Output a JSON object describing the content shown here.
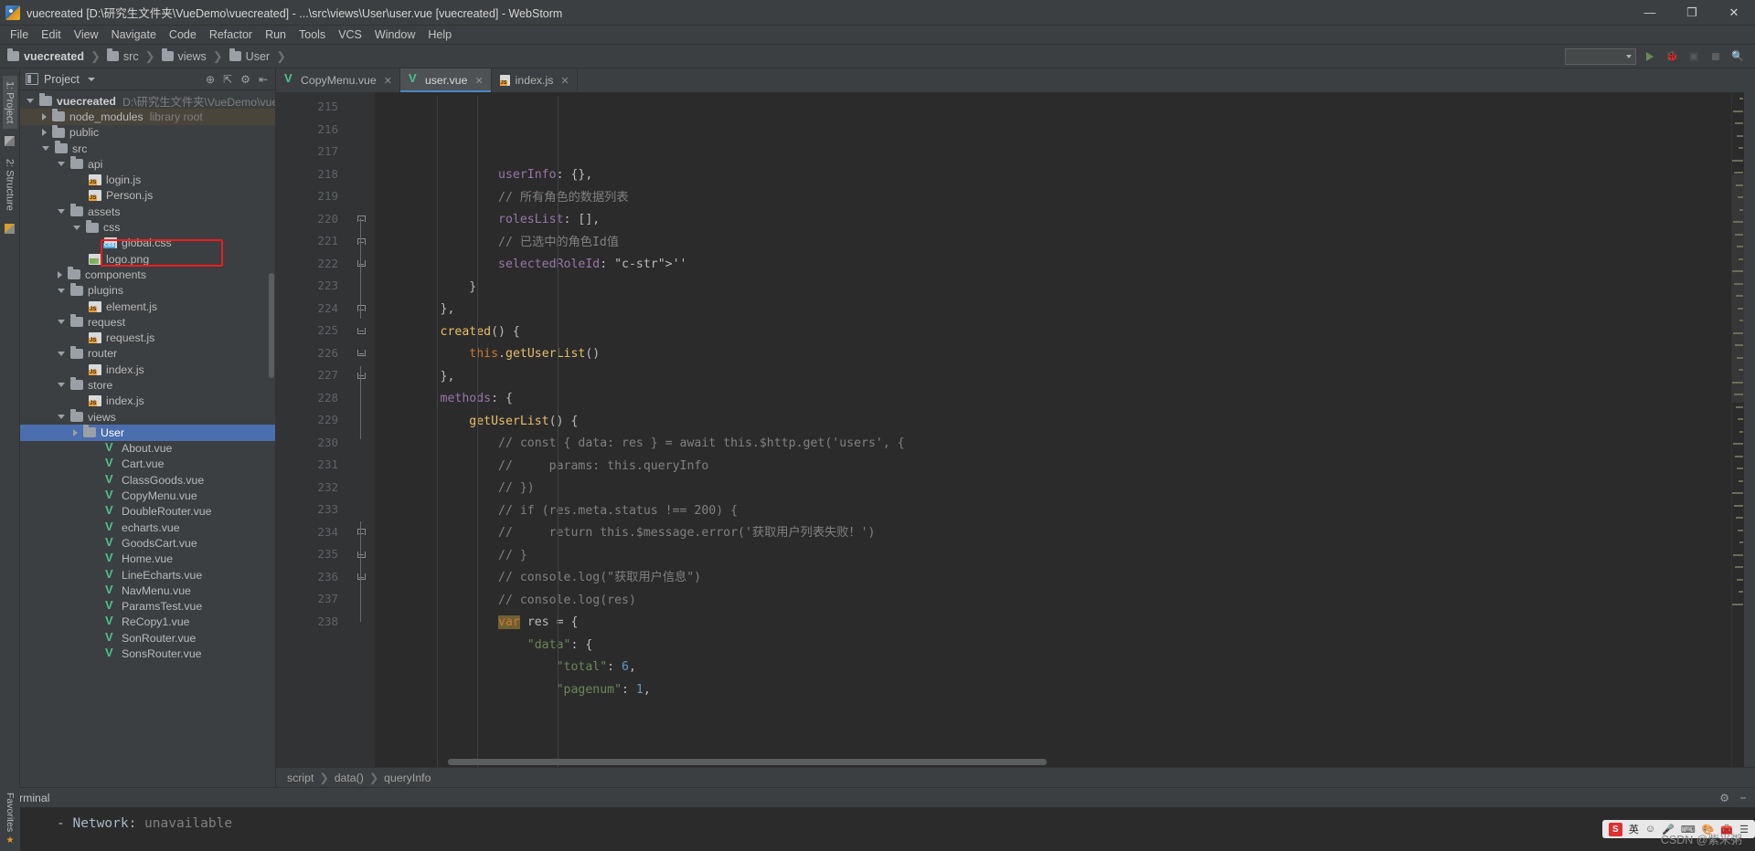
{
  "titlebar": {
    "title": "vuecreated [D:\\研究生文件夹\\VueDemo\\vuecreated] - ...\\src\\views\\User\\user.vue [vuecreated] - WebStorm",
    "minimize": "—",
    "maximize": "❐",
    "close": "✕",
    "app_icon": "webstorm-logo"
  },
  "menubar": {
    "items": [
      "File",
      "Edit",
      "View",
      "Navigate",
      "Code",
      "Refactor",
      "Run",
      "Tools",
      "VCS",
      "Window",
      "Help"
    ]
  },
  "breadcrumb": {
    "items": [
      "vuecreated",
      "src",
      "views",
      "User"
    ],
    "separator": "❯"
  },
  "left_rail": {
    "project_tab": "1: Project",
    "structure_tab": "2: Structure",
    "favorites_tab": "Favorites"
  },
  "project_panel": {
    "header_title": "Project",
    "tools": [
      "target-icon",
      "collapse-all-icon",
      "settings-icon",
      "hide-icon"
    ],
    "tree": [
      {
        "depth": 0,
        "twisty": "down",
        "icon": "folder",
        "label": "vuecreated",
        "bold": true,
        "sub": "D:\\研究生文件夹\\VueDemo\\vuecreated",
        "state": "normal"
      },
      {
        "depth": 1,
        "twisty": "right",
        "icon": "folder",
        "label": "node_modules",
        "bold": false,
        "sub": "library root",
        "state": "dim"
      },
      {
        "depth": 1,
        "twisty": "right",
        "icon": "folder",
        "label": "public",
        "bold": false,
        "sub": "",
        "state": "normal"
      },
      {
        "depth": 1,
        "twisty": "down",
        "icon": "folder",
        "label": "src",
        "bold": false,
        "sub": "",
        "state": "normal"
      },
      {
        "depth": 2,
        "twisty": "down",
        "icon": "folder",
        "label": "api",
        "bold": false,
        "sub": "",
        "state": "normal"
      },
      {
        "depth": 3,
        "twisty": "none",
        "icon": "js",
        "label": "login.js",
        "bold": false,
        "sub": "",
        "state": "normal"
      },
      {
        "depth": 3,
        "twisty": "none",
        "icon": "js",
        "label": "Person.js",
        "bold": false,
        "sub": "",
        "state": "normal"
      },
      {
        "depth": 2,
        "twisty": "down",
        "icon": "folder",
        "label": "assets",
        "bold": false,
        "sub": "",
        "state": "normal"
      },
      {
        "depth": 3,
        "twisty": "down",
        "icon": "folder",
        "label": "css",
        "bold": false,
        "sub": "",
        "state": "normal"
      },
      {
        "depth": 4,
        "twisty": "none",
        "icon": "css",
        "label": "global.css",
        "bold": false,
        "sub": "",
        "state": "normal"
      },
      {
        "depth": 3,
        "twisty": "none",
        "icon": "png",
        "label": "logo.png",
        "bold": false,
        "sub": "",
        "state": "normal"
      },
      {
        "depth": 2,
        "twisty": "right",
        "icon": "folder",
        "label": "components",
        "bold": false,
        "sub": "",
        "state": "normal"
      },
      {
        "depth": 2,
        "twisty": "down",
        "icon": "folder",
        "label": "plugins",
        "bold": false,
        "sub": "",
        "state": "normal"
      },
      {
        "depth": 3,
        "twisty": "none",
        "icon": "js",
        "label": "element.js",
        "bold": false,
        "sub": "",
        "state": "normal"
      },
      {
        "depth": 2,
        "twisty": "down",
        "icon": "folder",
        "label": "request",
        "bold": false,
        "sub": "",
        "state": "normal"
      },
      {
        "depth": 3,
        "twisty": "none",
        "icon": "js",
        "label": "request.js",
        "bold": false,
        "sub": "",
        "state": "normal"
      },
      {
        "depth": 2,
        "twisty": "down",
        "icon": "folder",
        "label": "router",
        "bold": false,
        "sub": "",
        "state": "normal"
      },
      {
        "depth": 3,
        "twisty": "none",
        "icon": "js",
        "label": "index.js",
        "bold": false,
        "sub": "",
        "state": "normal"
      },
      {
        "depth": 2,
        "twisty": "down",
        "icon": "folder",
        "label": "store",
        "bold": false,
        "sub": "",
        "state": "normal"
      },
      {
        "depth": 3,
        "twisty": "none",
        "icon": "js",
        "label": "index.js",
        "bold": false,
        "sub": "",
        "state": "normal"
      },
      {
        "depth": 2,
        "twisty": "down",
        "icon": "folder",
        "label": "views",
        "bold": false,
        "sub": "",
        "state": "normal"
      },
      {
        "depth": 3,
        "twisty": "right",
        "icon": "folder",
        "label": "User",
        "bold": false,
        "sub": "",
        "state": "selected"
      },
      {
        "depth": 4,
        "twisty": "none",
        "icon": "vue",
        "label": "About.vue",
        "bold": false,
        "sub": "",
        "state": "normal"
      },
      {
        "depth": 4,
        "twisty": "none",
        "icon": "vue",
        "label": "Cart.vue",
        "bold": false,
        "sub": "",
        "state": "normal"
      },
      {
        "depth": 4,
        "twisty": "none",
        "icon": "vue",
        "label": "ClassGoods.vue",
        "bold": false,
        "sub": "",
        "state": "normal"
      },
      {
        "depth": 4,
        "twisty": "none",
        "icon": "vue",
        "label": "CopyMenu.vue",
        "bold": false,
        "sub": "",
        "state": "normal"
      },
      {
        "depth": 4,
        "twisty": "none",
        "icon": "vue",
        "label": "DoubleRouter.vue",
        "bold": false,
        "sub": "",
        "state": "normal"
      },
      {
        "depth": 4,
        "twisty": "none",
        "icon": "vue",
        "label": "echarts.vue",
        "bold": false,
        "sub": "",
        "state": "normal"
      },
      {
        "depth": 4,
        "twisty": "none",
        "icon": "vue",
        "label": "GoodsCart.vue",
        "bold": false,
        "sub": "",
        "state": "normal"
      },
      {
        "depth": 4,
        "twisty": "none",
        "icon": "vue",
        "label": "Home.vue",
        "bold": false,
        "sub": "",
        "state": "normal"
      },
      {
        "depth": 4,
        "twisty": "none",
        "icon": "vue",
        "label": "LineEcharts.vue",
        "bold": false,
        "sub": "",
        "state": "normal"
      },
      {
        "depth": 4,
        "twisty": "none",
        "icon": "vue",
        "label": "NavMenu.vue",
        "bold": false,
        "sub": "",
        "state": "normal"
      },
      {
        "depth": 4,
        "twisty": "none",
        "icon": "vue",
        "label": "ParamsTest.vue",
        "bold": false,
        "sub": "",
        "state": "normal"
      },
      {
        "depth": 4,
        "twisty": "none",
        "icon": "vue",
        "label": "ReCopy1.vue",
        "bold": false,
        "sub": "",
        "state": "normal"
      },
      {
        "depth": 4,
        "twisty": "none",
        "icon": "vue",
        "label": "SonRouter.vue",
        "bold": false,
        "sub": "",
        "state": "normal"
      },
      {
        "depth": 4,
        "twisty": "none",
        "icon": "vue",
        "label": "SonsRouter.vue",
        "bold": false,
        "sub": "",
        "state": "normal"
      }
    ],
    "highlight_note": "red annotation box around global.css"
  },
  "editor": {
    "tabs": [
      {
        "label": "CopyMenu.vue",
        "icon": "vue",
        "active": false,
        "close": "✕"
      },
      {
        "label": "user.vue",
        "icon": "vue",
        "active": true,
        "close": "✕"
      },
      {
        "label": "index.js",
        "icon": "js",
        "active": false,
        "close": "✕"
      }
    ],
    "first_line_number": 215,
    "lines": [
      {
        "n": "215",
        "fold": "",
        "text": "                userInfo: {},"
      },
      {
        "n": "216",
        "fold": "",
        "text": "                // 所有角色的数据列表"
      },
      {
        "n": "217",
        "fold": "",
        "text": "                rolesList: [],"
      },
      {
        "n": "218",
        "fold": "",
        "text": "                // 已选中的角色Id值"
      },
      {
        "n": "219",
        "fold": "",
        "text": "                selectedRoleId: ''"
      },
      {
        "n": "220",
        "fold": "up",
        "text": "            }"
      },
      {
        "n": "221",
        "fold": "up",
        "text": "        },"
      },
      {
        "n": "222",
        "fold": "dn",
        "text": "        created() {"
      },
      {
        "n": "223",
        "fold": "",
        "text": "            this.getUserList()"
      },
      {
        "n": "224",
        "fold": "up",
        "text": "        },"
      },
      {
        "n": "225",
        "fold": "dn",
        "text": "        methods: {"
      },
      {
        "n": "226",
        "fold": "dn",
        "text": "            getUserList() {"
      },
      {
        "n": "227",
        "fold": "dn",
        "text": "                // const { data: res } = await this.$http.get('users', {"
      },
      {
        "n": "228",
        "fold": "",
        "text": "                //     params: this.queryInfo"
      },
      {
        "n": "229",
        "fold": "",
        "text": "                // })"
      },
      {
        "n": "230",
        "fold": "",
        "text": "                // if (res.meta.status !== 200) {"
      },
      {
        "n": "231",
        "fold": "",
        "text": "                //     return this.$message.error('获取用户列表失败！')"
      },
      {
        "n": "232",
        "fold": "",
        "text": "                // }"
      },
      {
        "n": "233",
        "fold": "",
        "text": "                // console.log(\"获取用户信息\")"
      },
      {
        "n": "234",
        "fold": "up",
        "text": "                // console.log(res)"
      },
      {
        "n": "235",
        "fold": "dn",
        "text": "                var res = {"
      },
      {
        "n": "236",
        "fold": "dn",
        "text": "                    \"data\": {"
      },
      {
        "n": "237",
        "fold": "",
        "text": "                        \"total\": 6,"
      },
      {
        "n": "238",
        "fold": "",
        "text": "                        \"pagenum\": 1,"
      }
    ],
    "breadcrumbs": [
      "script",
      "data()",
      "queryInfo"
    ],
    "breadcrumb_separator": "❯"
  },
  "terminal": {
    "title": "Terminal",
    "add_label": "+",
    "close_label": "✕",
    "output_dash": "-",
    "output_label": "Network:",
    "output_value": "unavailable",
    "tools": [
      "settings-icon",
      "hide-icon"
    ]
  },
  "statusbar": {
    "favorites_label": "Favorites",
    "watermark": "CSDN @紫米粥",
    "ime": {
      "logo": "S",
      "lang": "英",
      "icons": [
        "smiley-icon",
        "mic-icon",
        "keyboard-icon",
        "paint-icon",
        "tools-icon",
        "menu-icon"
      ]
    }
  },
  "colors": {
    "ide_bg": "#3c3f41",
    "editor_bg": "#2b2b2b",
    "selection_blue": "#4b6eaf",
    "annotation_red": "#ee1c1c",
    "vue_green": "#4fc08d",
    "comment_gray": "#808080",
    "keyword_orange": "#cc7832",
    "property_purple": "#9876aa",
    "function_yellow": "#e8bf6a",
    "number_blue": "#6897bb",
    "string_green": "#6a8759"
  }
}
